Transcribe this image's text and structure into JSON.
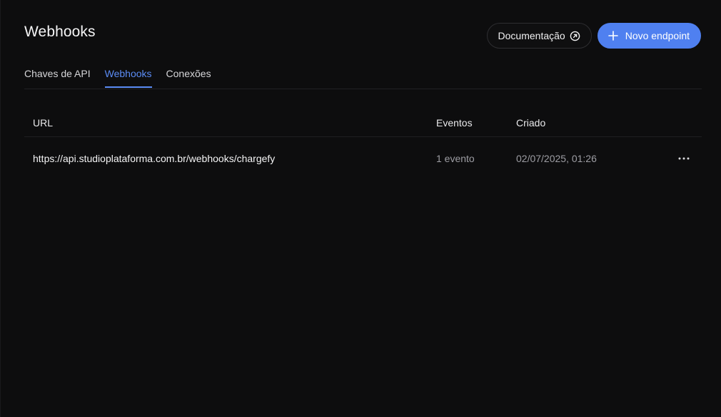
{
  "header": {
    "title": "Webhooks",
    "docs_button_label": "Documentação",
    "docs_icon": "external-link-circle-icon",
    "new_button_label": "Novo endpoint",
    "new_icon": "plus-icon"
  },
  "tabs": [
    {
      "label": "Chaves de API",
      "active": false
    },
    {
      "label": "Webhooks",
      "active": true
    },
    {
      "label": "Conexões",
      "active": false
    }
  ],
  "table": {
    "columns": [
      "URL",
      "Eventos",
      "Criado"
    ],
    "rows": [
      {
        "url": "https://api.studioplataforma.com.br/webhooks/chargefy",
        "events": "1 evento",
        "created": "02/07/2025, 01:26",
        "actions_icon": "more-horizontal-icon"
      }
    ]
  },
  "colors": {
    "background": "#0d0d0e",
    "accent": "#4f80f0",
    "active_tab": "#5b8cf5",
    "muted_text": "#9d9da3"
  }
}
